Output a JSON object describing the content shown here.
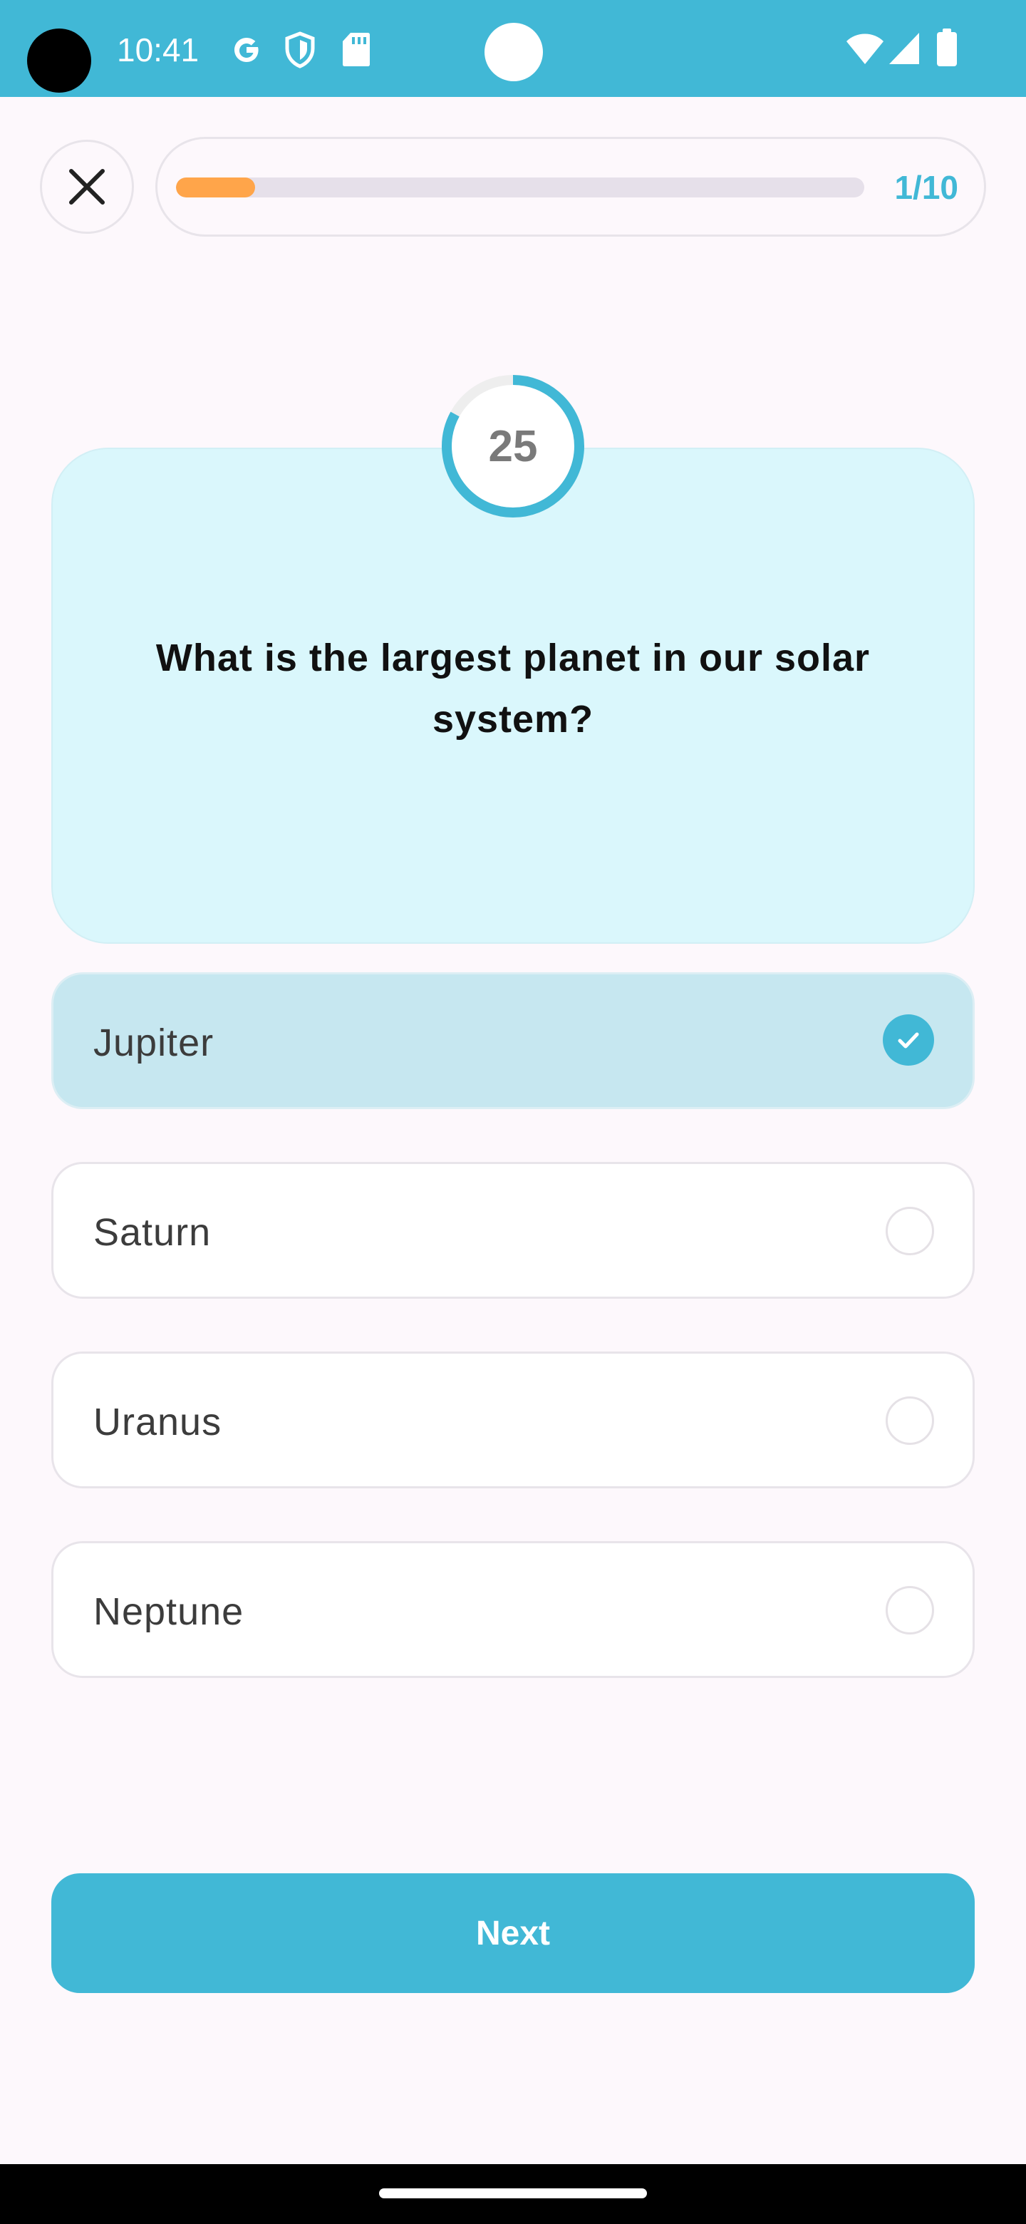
{
  "status_bar": {
    "time": "10:41",
    "icons": [
      "google-icon",
      "shield-icon",
      "sd-card-icon",
      "wifi-icon",
      "signal-icon",
      "battery-icon"
    ]
  },
  "quiz": {
    "progress_text": "1/10",
    "progress_fraction": 0.1,
    "timer_value": "25",
    "timer_fraction_remaining": 0.83,
    "question": "What is the largest planet in our solar system?",
    "options": [
      {
        "label": "Jupiter",
        "selected": true
      },
      {
        "label": "Saturn",
        "selected": false
      },
      {
        "label": "Uranus",
        "selected": false
      },
      {
        "label": "Neptune",
        "selected": false
      }
    ],
    "next_label": "Next"
  },
  "colors": {
    "accent": "#41B8D6",
    "progress_fill": "#FFA54A",
    "card_bg": "#DAF7FC",
    "selected_option_bg": "#C6E7F0",
    "page_bg": "#FDF8FC"
  }
}
